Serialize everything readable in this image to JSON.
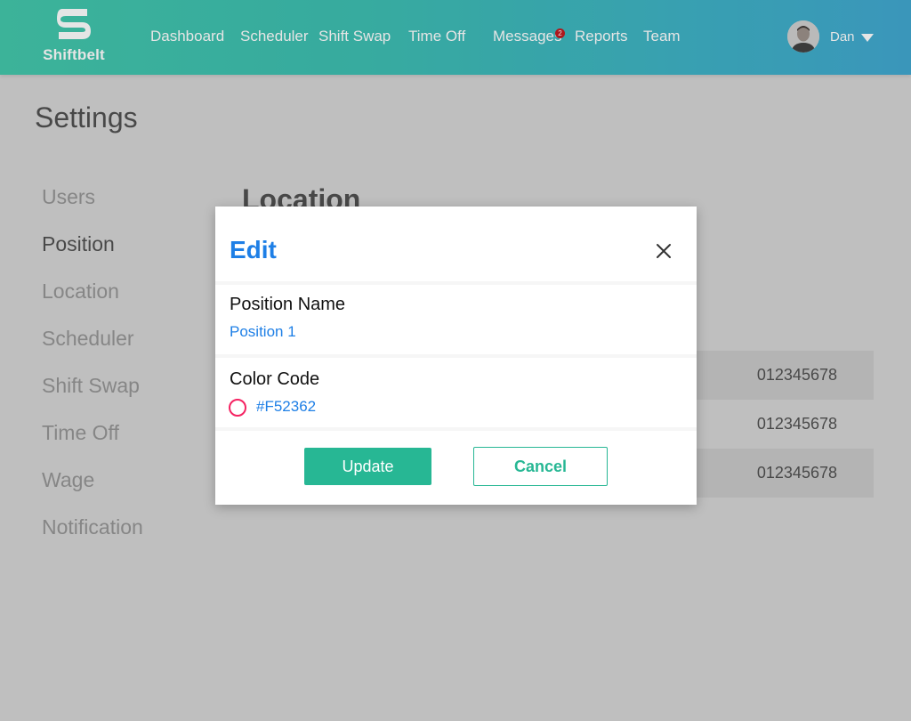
{
  "app": {
    "brand": "Shiftbelt",
    "accent_color": "#27b794",
    "link_color": "#1e7fe6"
  },
  "nav": {
    "items": [
      {
        "label": "Dashboard"
      },
      {
        "label": "Scheduler"
      },
      {
        "label": "Shift Swap"
      },
      {
        "label": "Time Off"
      },
      {
        "label": "Messages",
        "badge": "2"
      },
      {
        "label": "Reports"
      },
      {
        "label": "Team"
      }
    ],
    "user": {
      "name": "Dan",
      "avatar_icon": "user-avatar",
      "caret_icon": "caret-down-icon"
    }
  },
  "page": {
    "title": "Settings",
    "sidebar": [
      {
        "label": "Users",
        "active": false
      },
      {
        "label": "Position",
        "active": true
      },
      {
        "label": "Location",
        "active": false
      },
      {
        "label": "Scheduler",
        "active": false
      },
      {
        "label": "Shift Swap",
        "active": false
      },
      {
        "label": "Time Off",
        "active": false
      },
      {
        "label": "Wage",
        "active": false
      },
      {
        "label": "Notification",
        "active": false
      }
    ],
    "content_heading": "Location",
    "rows": [
      {
        "value": "012345678"
      },
      {
        "value": "012345678"
      },
      {
        "value": "012345678"
      }
    ]
  },
  "modal": {
    "title": "Edit",
    "close_icon": "close-icon",
    "position_name_label": "Position Name",
    "position_name_value": "Position 1",
    "color_code_label": "Color Code",
    "color_code_value": "#F52362",
    "color_swatch": "#F52362",
    "update_label": "Update",
    "cancel_label": "Cancel"
  }
}
